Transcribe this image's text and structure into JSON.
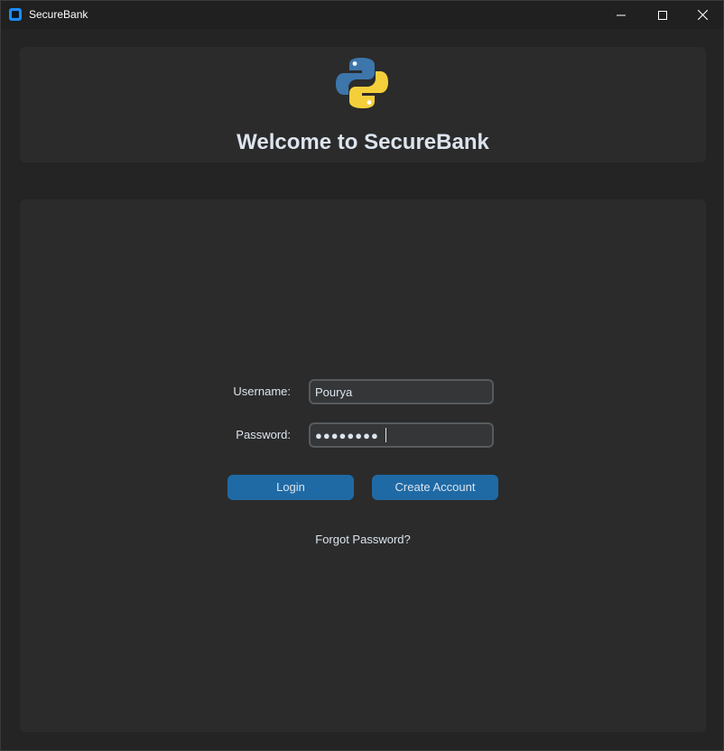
{
  "window": {
    "title": "SecureBank",
    "controls": [
      "minimize-icon",
      "maximize-icon",
      "close-icon"
    ]
  },
  "header": {
    "logo_icon": "python-logo-icon",
    "welcome_text": "Welcome to SecureBank"
  },
  "login_form": {
    "username_label": "Username:",
    "username_value": "Pourya",
    "password_label": "Password:",
    "password_value": "●●●●●●●●",
    "login_button": "Login",
    "create_account_button": "Create Account",
    "forgot_password_link": "Forgot Password?"
  },
  "colors": {
    "window_bg": "#242424",
    "frame_bg": "#2b2b2b",
    "entry_bg": "#343638",
    "entry_border": "#565b5e",
    "button_accent": "#1f6aa5",
    "text": "#dce4ee"
  }
}
